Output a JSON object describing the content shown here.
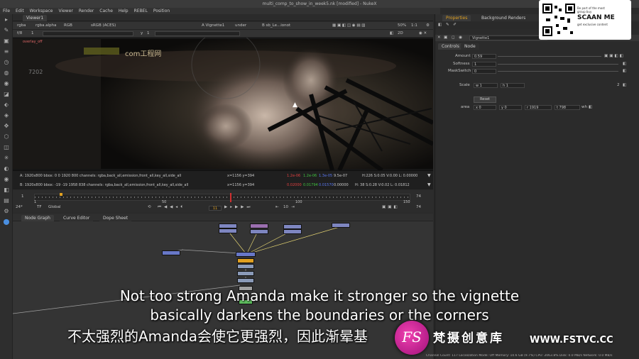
{
  "window": {
    "title": "multi_comp_to_show_in_week5.nk [modified] - NukeX"
  },
  "menu": [
    "File",
    "Edit",
    "Workspace",
    "Viewer",
    "Render",
    "Cache",
    "Help",
    "REBEL",
    "Position"
  ],
  "viewer": {
    "tab": "Viewer1",
    "channels": "rgba",
    "alpha": "rgba.alpha",
    "colorspace_mode": "RGB",
    "colorspace": "sRGB (ACES)",
    "input_a": "A  Vignette1",
    "merge_op": "under",
    "input_b": "B  sb_Le...ionot",
    "zoom": "50%",
    "ratio": "1:1",
    "view_mode": "2D",
    "frame_range": "f/8",
    "gain_label": "1",
    "gamma_label": "y",
    "gamma_value": "1",
    "overlay_label": "overlay_off",
    "watermark_text": "com工程网",
    "watermark_small": "7202",
    "line_a_left": "A:   1920x800  bbox: 0 0 1920 800 channels: rgba,back_all,emission,front_all,key_all,side_all",
    "line_a_coords": "x=1156 y=394",
    "line_a_vals": [
      "1.2e-06",
      "1.2e-06",
      "1.3e-05",
      "9.5e-07"
    ],
    "line_a_hsv": "H:226 S:0.05 V:0.00  L: 0.00000",
    "line_b_left": "B:   1920x800  bbox: -19 -19 1958 838 channels: rgba,back_all,emission,front_all,key_all,side_all",
    "line_b_coords": "x=1156 y=394",
    "line_b_vals": [
      "0.02000",
      "0.01794",
      "0.01570",
      "0.00000"
    ],
    "line_b_hsv": "H: 38 S:0.28 V:0.02  L: 0.01812"
  },
  "timeline": {
    "start": "1",
    "end": "74",
    "end2": "74",
    "fps": "24*",
    "tf": "TF",
    "scope": "Global",
    "ticks": [
      "1",
      "50",
      "100",
      "150"
    ],
    "current_frame": "11",
    "step": "10"
  },
  "node_tabs": [
    "Node Graph",
    "Curve Editor",
    "Dope Sheet"
  ],
  "props": {
    "tabs": [
      "Properties",
      "Background Renders"
    ],
    "node_name": "Vignette1",
    "subtabs": [
      "Controls",
      "Node"
    ],
    "amount_label": "Amount",
    "amount_value": "0.59",
    "softness_label": "Softness",
    "softness_value": "1",
    "maskswitch_label": "MaskSwitch",
    "maskswitch_value": "0",
    "scale_label": "Scale",
    "scale_w": "w 1",
    "scale_h": "h 1",
    "scale_count": "2",
    "reset_label": "Reset",
    "area_label": "area",
    "area_x": "x 0",
    "area_y": "y 0",
    "area_r": "r 1919",
    "area_t": "t 798",
    "area_unit": "wh"
  },
  "qr_badge": {
    "line1": "Be part of the most",
    "line2": "group buy",
    "brand": "SCAAN ME",
    "line3": "get exclusive content"
  },
  "subtitles": {
    "en_line1": "Not too strong Amanda make it stronger so the vignette",
    "en_line2": "basically darkens the boundaries or the corners",
    "zh_line": "不太强烈的Amanda会使它更强烈，因此渐晕基"
  },
  "brand_logo": {
    "text": "梵摄创意库",
    "url": "WWW.FSTVC.CC",
    "mark": "FS"
  },
  "statusbar": "Channel Count: 117  Localization Mode: Off  Memory: 10.6 GB (9.7%) CPU: 2063.8% Disk: 0.0 MB/s Network: 0.0 MB/s",
  "colors": {
    "accent": "#e0a020",
    "node_blue": "#7888c8",
    "selected": "#f0c000",
    "brand_pink": "#e0189c"
  }
}
